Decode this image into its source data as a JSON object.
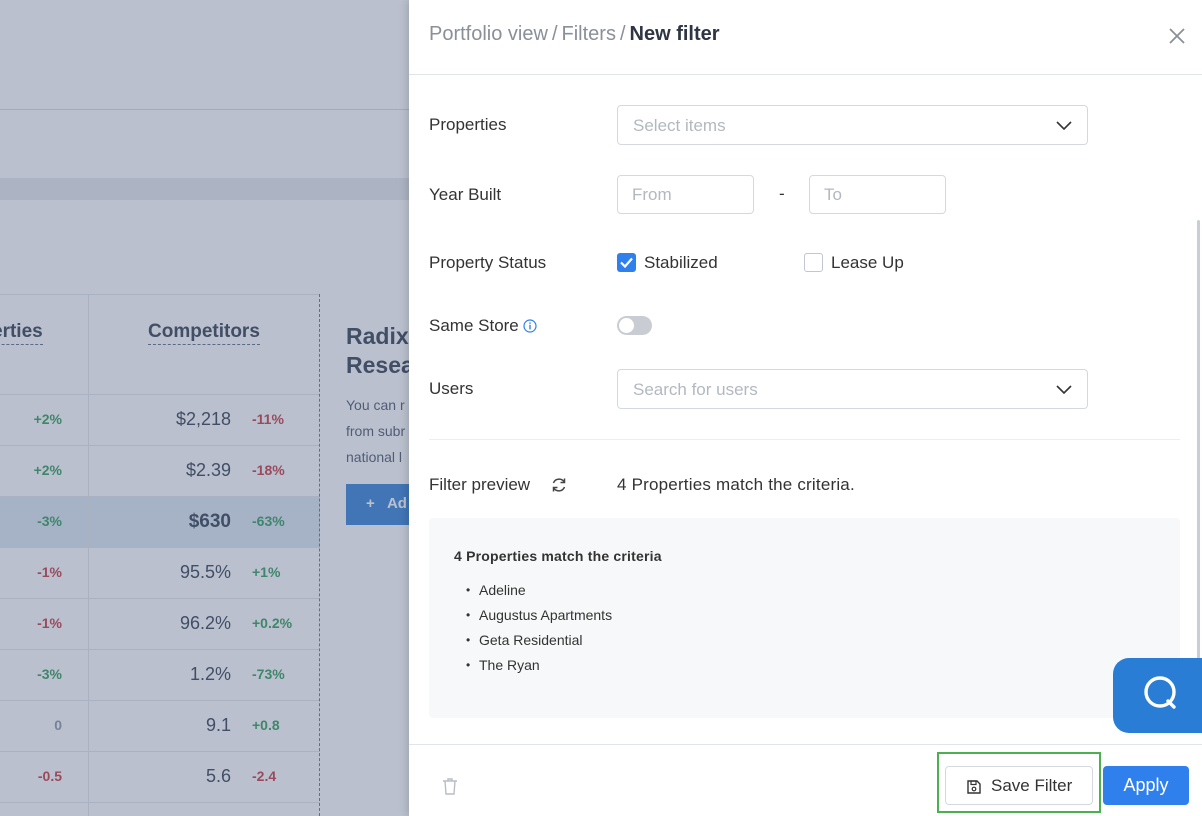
{
  "background": {
    "col_a_header": "erties",
    "col_b_header": "Competitors",
    "rows": [
      {
        "a_change": "+2%",
        "a_tone": "pos",
        "b_value": "$2,218",
        "b_change": "-11%",
        "b_tone": "neg",
        "highlight": false
      },
      {
        "a_change": "+2%",
        "a_tone": "pos",
        "b_value": "$2.39",
        "b_change": "-18%",
        "b_tone": "neg",
        "highlight": false
      },
      {
        "a_change": "-3%",
        "a_tone": "pos",
        "b_value": "$630",
        "b_change": "-63%",
        "b_tone": "pos",
        "highlight": true
      },
      {
        "a_change": "-1%",
        "a_tone": "neg",
        "b_value": "95.5%",
        "b_change": "+1%",
        "b_tone": "pos",
        "highlight": false
      },
      {
        "a_change": "-1%",
        "a_tone": "neg",
        "b_value": "96.2%",
        "b_change": "+0.2%",
        "b_tone": "pos",
        "highlight": false
      },
      {
        "a_change": "-3%",
        "a_tone": "pos",
        "b_value": "1.2%",
        "b_change": "-73%",
        "b_tone": "pos",
        "highlight": false
      },
      {
        "a_change": "0",
        "a_tone": "neu",
        "b_value": "9.1",
        "b_change": "+0.8",
        "b_tone": "pos",
        "highlight": false
      },
      {
        "a_change": "-0.5",
        "a_tone": "neg",
        "b_value": "5.6",
        "b_change": "-2.4",
        "b_tone": "neg",
        "highlight": false
      }
    ],
    "radix_title": "Radix\nResea",
    "radix_text": "You can r\nfrom subr\nnational l",
    "radix_add": "Ad"
  },
  "header": {
    "breadcrumb": [
      "Portfolio view",
      "Filters"
    ],
    "separator": "/",
    "current": "New filter"
  },
  "form": {
    "properties_label": "Properties",
    "properties_placeholder": "Select items",
    "year_built_label": "Year Built",
    "from_placeholder": "From",
    "to_placeholder": "To",
    "range_dash": "-",
    "property_status_label": "Property Status",
    "status_options": [
      {
        "label": "Stabilized",
        "checked": true
      },
      {
        "label": "Lease Up",
        "checked": false
      }
    ],
    "same_store_label": "Same Store",
    "same_store_enabled": false,
    "users_label": "Users",
    "users_placeholder": "Search for users"
  },
  "preview": {
    "label": "Filter preview",
    "summary": "4 Properties match the criteria.",
    "box_title": "4 Properties match the criteria",
    "properties": [
      "Adeline",
      "Augustus Apartments",
      "Geta Residential",
      "The Ryan"
    ]
  },
  "footer": {
    "save_label": "Save Filter",
    "apply_label": "Apply"
  },
  "icons": {
    "close": "close-icon",
    "chevron": "chevron-down-icon",
    "info": "info-icon",
    "refresh": "refresh-icon",
    "trash": "trash-icon",
    "save": "save-icon",
    "chat": "chat-icon",
    "check": "check-icon"
  },
  "colors": {
    "primary": "#2f80ed",
    "highlight_border": "#4caf50",
    "positive": "#2e9b55",
    "negative": "#c7363f"
  }
}
